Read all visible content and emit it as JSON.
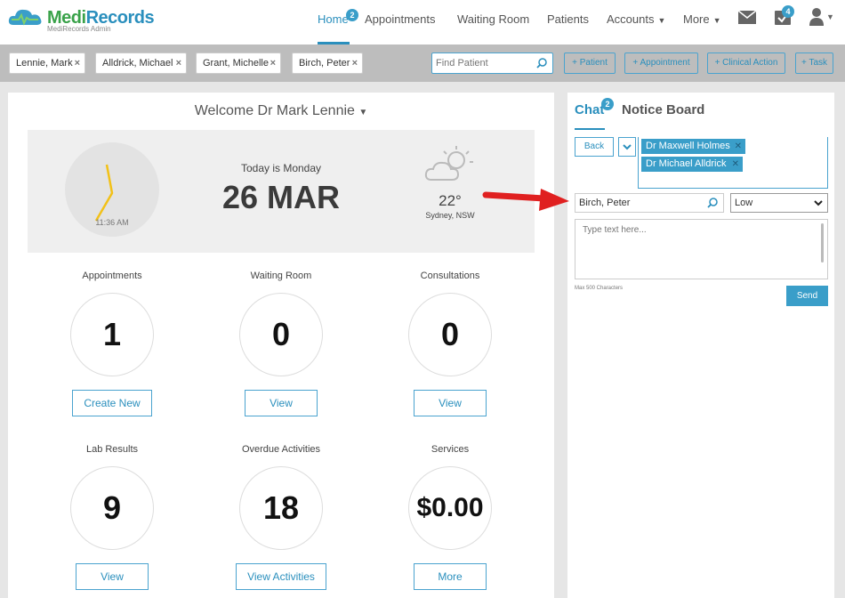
{
  "header": {
    "logo_name_a": "Medi",
    "logo_name_b": "Records",
    "logo_sub": "MediRecords Admin",
    "nav": [
      {
        "label": "Home",
        "badge": "2"
      },
      {
        "label": "Appointments"
      },
      {
        "label": "Waiting Room"
      },
      {
        "label": "Patients"
      },
      {
        "label": "Accounts"
      },
      {
        "label": "More"
      }
    ],
    "tasks_badge": "4"
  },
  "patient_tabs": [
    "Lennie, Mark",
    "Alldrick, Michael",
    "Grant, Michelle",
    "Birch, Peter"
  ],
  "tab_close": "×",
  "search": {
    "placeholder": "Find Patient"
  },
  "actions": [
    "+ Patient",
    "+ Appointment",
    "+ Clinical Action",
    "+ Task"
  ],
  "dashboard": {
    "welcome": "Welcome Dr Mark Lennie",
    "clock_time": "11:36 AM",
    "today_label": "Today is Monday",
    "date": "26 MAR",
    "temperature": "22°",
    "location": "Sydney, NSW",
    "stats": [
      {
        "title": "Appointments",
        "value": "1",
        "button": "Create New"
      },
      {
        "title": "Waiting Room",
        "value": "0",
        "button": "View"
      },
      {
        "title": "Consultations",
        "value": "0",
        "button": "View"
      },
      {
        "title": "Lab Results",
        "value": "9",
        "button": "View"
      },
      {
        "title": "Overdue Activities",
        "value": "18",
        "button": "View Activities"
      },
      {
        "title": "Services",
        "value": "$0.00",
        "button": "More"
      }
    ]
  },
  "chat": {
    "tab_chat": "Chat",
    "chat_badge": "2",
    "tab_notice": "Notice Board",
    "back": "Back",
    "recipients": [
      "Dr Maxwell Holmes",
      "Dr Michael Alldrick"
    ],
    "patient": "Birch, Peter",
    "priority": "Low",
    "message_placeholder": "Type text here...",
    "max_chars": "Max 500 Characters",
    "send": "Send"
  },
  "colors": {
    "accent": "#2a8fbd",
    "badge": "#3a9ec9",
    "logo_green": "#3aa24a",
    "arrow": "#e02020"
  }
}
